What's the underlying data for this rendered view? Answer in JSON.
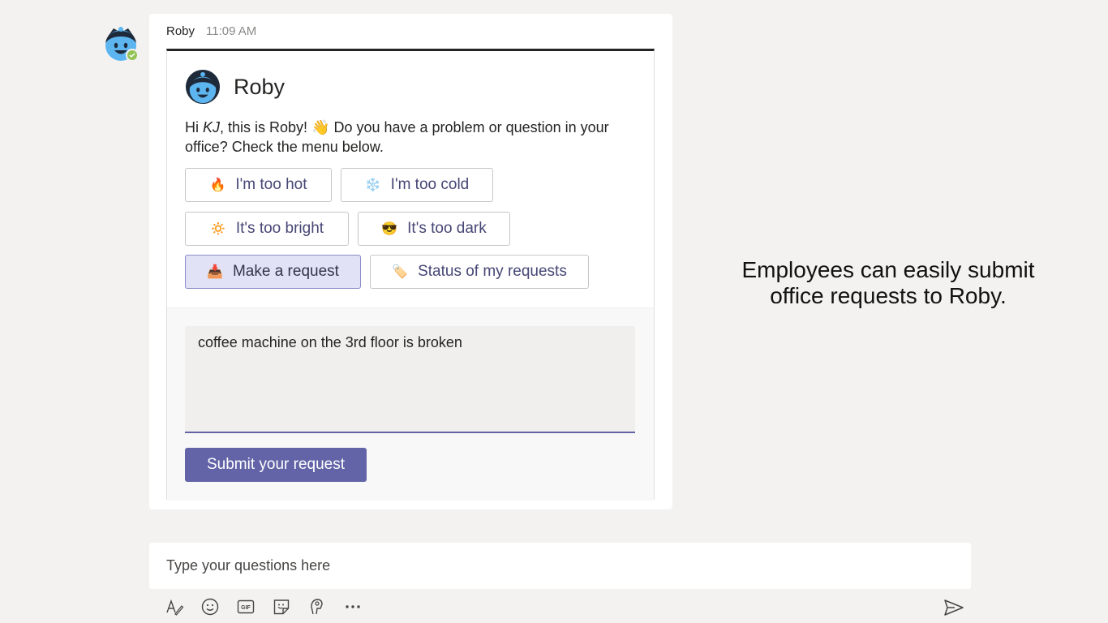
{
  "message": {
    "author": "Roby",
    "time": "11:09 AM"
  },
  "card": {
    "title": "Roby",
    "intro_prefix": "Hi ",
    "intro_name": "KJ",
    "intro_suffix": ", this is Roby! 👋  Do you have a problem or question in your office? Check the menu below.",
    "buttons": [
      {
        "emoji": "🔥",
        "label": "I'm too hot"
      },
      {
        "emoji": "❄️",
        "label": "I'm too cold"
      },
      {
        "emoji": "🔅",
        "label": "It's too bright"
      },
      {
        "emoji": "😎",
        "label": "It's too dark"
      },
      {
        "emoji": "📥",
        "label": "Make a request"
      },
      {
        "emoji": "🏷️",
        "label": "Status of my requests"
      }
    ],
    "request_text": "coffee machine on the 3rd floor is broken",
    "submit_label": "Submit your request"
  },
  "caption": "Employees can easily submit office requests to Roby.",
  "compose": {
    "placeholder": "Type your questions here",
    "tools": [
      "format-icon",
      "emoji-icon",
      "gif-icon",
      "sticker-icon",
      "praise-icon",
      "more-icon"
    ]
  },
  "colors": {
    "accent": "#6264a7",
    "background": "#f3f2f1",
    "selected": "#e2e2f6"
  }
}
